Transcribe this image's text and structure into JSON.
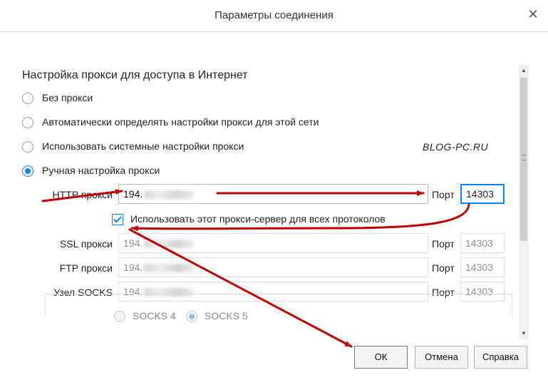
{
  "window": {
    "title": "Параметры соединения"
  },
  "proxy": {
    "heading": "Настройка прокси для доступа в Интернет",
    "options": [
      {
        "label": "Без прокси",
        "checked": false
      },
      {
        "label": "Автоматически определять настройки прокси для этой сети",
        "checked": false
      },
      {
        "label": "Использовать системные настройки прокси",
        "checked": false
      },
      {
        "label": "Ручная настройка прокси",
        "checked": true
      }
    ],
    "http": {
      "label": "HTTP прокси",
      "value": "194.",
      "port_label": "Порт",
      "port": "14303"
    },
    "use_for_all": {
      "label": "Использовать этот прокси-сервер для всех протоколов",
      "checked": true
    },
    "ssl": {
      "label": "SSL прокси",
      "value": "194.",
      "port_label": "Порт",
      "port": "14303"
    },
    "ftp": {
      "label": "FTP прокси",
      "value": "194.",
      "port_label": "Порт",
      "port": "14303"
    },
    "socks": {
      "label": "Узел SOCKS",
      "value": "194.",
      "port_label": "Порт",
      "port": "14303"
    },
    "socks_versions": [
      {
        "label": "SOCKS 4",
        "checked": false
      },
      {
        "label": "SOCKS 5",
        "checked": true
      }
    ]
  },
  "watermark": "BLOG-PC.RU",
  "buttons": {
    "ok": "ОК",
    "cancel": "Отмена",
    "help": "Справка"
  },
  "colors": {
    "accent": "#0a84ff",
    "arrow": "#c00000"
  }
}
